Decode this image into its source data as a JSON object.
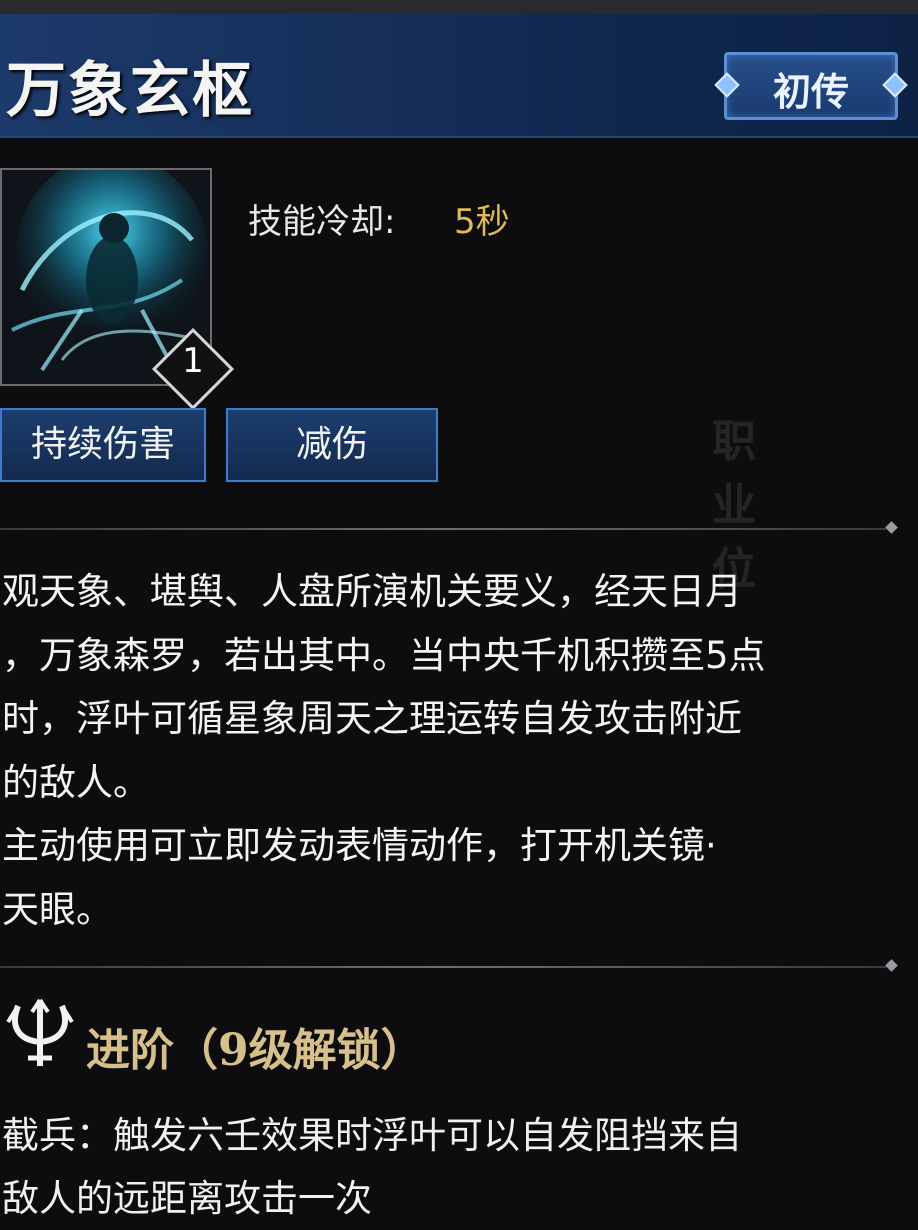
{
  "header": {
    "title": "万象玄枢",
    "rank": "初传"
  },
  "skill": {
    "icon": "skill-wanxiang-icon",
    "level": "1",
    "cooldown_label": "技能冷却:",
    "cooldown_value": "5秒",
    "tags": [
      "持续伤害",
      "减伤"
    ]
  },
  "description": "观天象、堪舆、人盘所演机关要义，经天日月\n，万象森罗，若出其中。当中央千机积攒至5点\n时，浮叶可循星象周天之理运转自发攻击附近\n的敌人。\n主动使用可立即发动表情动作，打开机关镜·\n天眼。",
  "advanced": {
    "icon": "trident-icon",
    "title": "进阶（9级解锁）",
    "description": "截兵：触发六壬效果时浮叶可以自发阻挡来自\n敌人的远距离攻击一次"
  },
  "colors": {
    "header_bg": "#1c3a6b",
    "cooldown_value": "#e0b95a",
    "advanced_title": "#d8c08a",
    "tag_border": "#3b7bd0"
  }
}
